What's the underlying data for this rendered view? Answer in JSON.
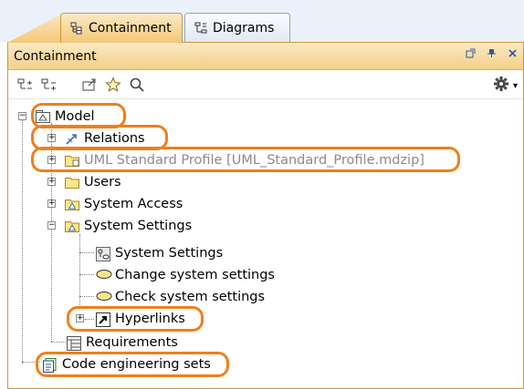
{
  "tabs": [
    {
      "label": "Containment",
      "icon": "containment-tree-icon",
      "active": true
    },
    {
      "label": "Diagrams",
      "icon": "diagrams-icon",
      "active": false
    }
  ],
  "panel": {
    "title": "Containment",
    "header_controls": [
      "undock-icon",
      "pin-icon",
      "close-icon"
    ]
  },
  "toolbar": {
    "buttons": [
      "collapse-all-icon",
      "expand-all-icon",
      "open-icon",
      "favorite-star-icon",
      "search-icon"
    ],
    "options_icon": "gear-icon"
  },
  "tree": {
    "model": "Model",
    "relations": "Relations",
    "uml_profile": "UML Standard Profile [UML_Standard_Profile.mdzip]",
    "users": "Users",
    "system_access": "System Access",
    "system_settings": "System Settings",
    "system_settings_diagram": "System Settings",
    "change_settings": "Change system settings",
    "check_settings": "Check system settings",
    "hyperlinks": "Hyperlinks",
    "requirements": "Requirements",
    "code_sets": "Code engineering sets"
  },
  "colors": {
    "accent_orange": "#f07f19",
    "header_gold": "#f4cf88",
    "tab_blue": "#eaf1fb"
  }
}
